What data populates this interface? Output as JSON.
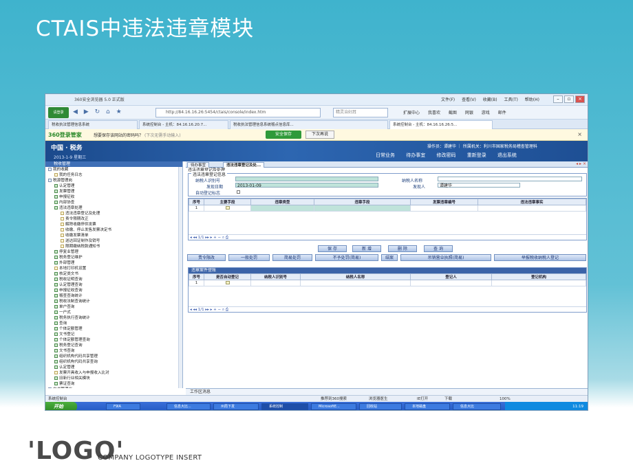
{
  "slide": {
    "title": "CTAIS中违法违章模块",
    "logo": "'LOGO'",
    "company_line": "COMPANY LOGOTYPE INSERT"
  },
  "browser": {
    "window_title": "360安全浏览器 5.0 正式版",
    "menus": [
      "文件(F)",
      "查看(V)",
      "收藏(B)",
      "工具(T)",
      "帮助(H)"
    ],
    "login_label": "请登录",
    "address": "http://84.16.16.26:5454/ctais/console/index.htm",
    "search_placeholder": "精灵治妇耳",
    "right_tools": [
      "扩展中心",
      "我喜欢",
      "截图",
      "网银",
      "游戏",
      "邮件"
    ],
    "tabs": [
      "税收执法管理信息系统",
      "系统控制台 - 主机：84.16.16.20:7...",
      "税收执法管理信息系统稽点信息库...",
      "系统控制台 - 主机：84.16.16.26:5..."
    ],
    "password_bar": {
      "brand": "360登录管家",
      "question": "想要保存该网站的密码吗？",
      "hint": "(下次无需手动输入)",
      "save_label": "安全保存",
      "next_label": "下次再说"
    },
    "status_items": [
      "系统控制台",
      "推荐到360搜索",
      "浏览器医生",
      "IE打开",
      "下载",
      "100%"
    ]
  },
  "app": {
    "brand": "中国 · 税务",
    "date": "2013-1-9  星期三",
    "user_info": "操作员：谭建华  ｜  所属机关：利川市国家税务局稽查管理科",
    "nav": [
      "日常业务",
      "待办事宜",
      "修改密码",
      "重新登录",
      "退出系统"
    ]
  },
  "tree": {
    "header": "税收管理",
    "items": [
      {
        "label": "我的收藏",
        "level": 1,
        "icon": "folder"
      },
      {
        "label": "我的任务日志",
        "level": 2,
        "icon": "doc"
      },
      {
        "label": "税源管理岗",
        "level": 1,
        "icon": "folder"
      },
      {
        "label": "认定管理",
        "level": 2,
        "icon": "folder"
      },
      {
        "label": "发票管理",
        "level": 2,
        "icon": "folder"
      },
      {
        "label": "申报征收",
        "level": 2,
        "icon": "folder"
      },
      {
        "label": "内部协查",
        "level": 2,
        "icon": "folder"
      },
      {
        "label": "违法违章处理",
        "level": 2,
        "icon": "folder"
      },
      {
        "label": "违法违章登记及处理",
        "level": 3,
        "icon": "doc"
      },
      {
        "label": "责令限期改正",
        "level": 3,
        "icon": "doc"
      },
      {
        "label": "解除收缴停供发票",
        "level": 3,
        "icon": "doc"
      },
      {
        "label": "收缴、停止发售发票决定书",
        "level": 3,
        "icon": "doc"
      },
      {
        "label": "收缴发票清单",
        "level": 3,
        "icon": "doc"
      },
      {
        "label": "送达回证制作及销号",
        "level": 3,
        "icon": "doc"
      },
      {
        "label": "限期缴纳税款通知书",
        "level": 3,
        "icon": "doc"
      },
      {
        "label": "停复业管理",
        "level": 2,
        "icon": "folder"
      },
      {
        "label": "税务登记维护",
        "level": 2,
        "icon": "folder"
      },
      {
        "label": "外部管理",
        "level": 2,
        "icon": "folder"
      },
      {
        "label": "本地打印机设置",
        "level": 2,
        "icon": "doc"
      },
      {
        "label": "核定类文书",
        "level": 2,
        "icon": "folder"
      },
      {
        "label": "税收证明查询",
        "level": 2,
        "icon": "folder"
      },
      {
        "label": "认定管理查询",
        "level": 2,
        "icon": "folder"
      },
      {
        "label": "申报征收查询",
        "level": 2,
        "icon": "folder"
      },
      {
        "label": "稽查查询统计",
        "level": 2,
        "icon": "folder"
      },
      {
        "label": "税收法制查询统计",
        "level": 2,
        "icon": "folder"
      },
      {
        "label": "单户查询",
        "level": 2,
        "icon": "folder"
      },
      {
        "label": "一户式",
        "level": 2,
        "icon": "folder"
      },
      {
        "label": "税务执行查询统计",
        "level": 2,
        "icon": "folder"
      },
      {
        "label": "查询",
        "level": 2,
        "icon": "folder"
      },
      {
        "label": "个体定额管理",
        "level": 2,
        "icon": "folder"
      },
      {
        "label": "文书登记",
        "level": 2,
        "icon": "folder"
      },
      {
        "label": "个体定额管理查询",
        "level": 2,
        "icon": "folder"
      },
      {
        "label": "税务登记查询",
        "level": 2,
        "icon": "folder"
      },
      {
        "label": "文书查询",
        "level": 2,
        "icon": "folder"
      },
      {
        "label": "组织机构代码共享管理",
        "level": 2,
        "icon": "folder"
      },
      {
        "label": "组织机构代码共享查询",
        "level": 2,
        "icon": "folder"
      },
      {
        "label": "认定管理",
        "level": 2,
        "icon": "folder"
      },
      {
        "label": "发票开具收入与申报收入比对",
        "level": 2,
        "icon": "doc"
      },
      {
        "label": "旧新行业相关模块",
        "level": 2,
        "icon": "folder"
      },
      {
        "label": "票证查询",
        "level": 2,
        "icon": "folder"
      },
      {
        "label": "文书管理岗",
        "level": 1,
        "icon": "folder"
      }
    ]
  },
  "content": {
    "tabs": [
      "待办事宜",
      "违法违章登记及处..."
    ],
    "section_title": "违法违章登记及处理",
    "form": {
      "legend": "违法违章登记信息",
      "taxpayer_id_label": "纳税人识别号",
      "taxpayer_id_value": "",
      "found_date_label": "发现日期",
      "found_date_value": "2013-01-09",
      "auto_flag_label": "自动登记标志",
      "taxpayer_name_label": "纳税人名称",
      "taxpayer_name_value": "",
      "finder_label": "发现人",
      "finder_value": "谭建华"
    },
    "grid1": {
      "columns": [
        "序号",
        "主要手段",
        "违章类型",
        "违章手段",
        "发票违章编号",
        "违法违章事实"
      ],
      "rows": [
        [
          "1",
          "",
          "",
          "",
          "",
          ""
        ]
      ],
      "pager": "1/1"
    },
    "action_buttons": [
      "保 存",
      "新 增",
      "删 除",
      "查 询"
    ],
    "process_buttons": [
      "责令限改",
      "一般处罚",
      "简易处罚",
      "不予处罚(简易)",
      "结案",
      "吊销营业执照(简易)",
      "举报税收纳税人登记"
    ],
    "grid2": {
      "title": "违章案件登账",
      "columns": [
        "序号",
        "是否自动登记",
        "纳税人识别号",
        "纳税人名称",
        "登记人",
        "登记机构"
      ],
      "rows": [
        [
          "1",
          "",
          "",
          "",
          "",
          ""
        ]
      ],
      "pager": "1/1"
    },
    "message_bar": "工作区消息"
  },
  "taskbar": {
    "start": "开始",
    "items": [
      "F9IA",
      "信息大比...",
      "州局下发",
      "系统控制",
      "MicrosoftE...",
      "回收站",
      "本地磁盘",
      "信息大比"
    ],
    "tray_time": "11:19"
  }
}
